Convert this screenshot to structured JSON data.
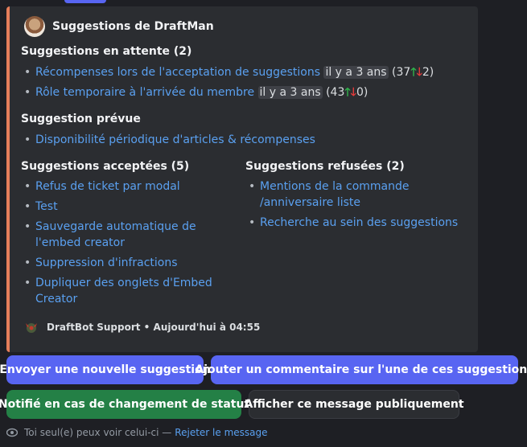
{
  "embed": {
    "accent_color": "#e67e5a",
    "author": {
      "name": "Suggestions de DraftMan"
    },
    "pending": {
      "title": "Suggestions en attente (2)",
      "items": [
        {
          "label": "Récompenses lors de l'acceptation de suggestions",
          "time": "il y a 3 ans",
          "up": "37",
          "down": "2"
        },
        {
          "label": "Rôle temporaire à l'arrivée du membre",
          "time": "il y a 3 ans",
          "up": "43",
          "down": "0"
        }
      ]
    },
    "planned": {
      "title": "Suggestion prévue",
      "items": [
        "Disponibilité périodique d'articles & récompenses"
      ]
    },
    "accepted": {
      "title": "Suggestions acceptées (5)",
      "items": [
        "Refus de ticket par modal",
        "Test",
        "Sauvegarde automatique de l'embed creator",
        "Suppression d'infractions",
        "Dupliquer des onglets d'Embed Creator"
      ]
    },
    "refused": {
      "title": "Suggestions refusées (2)",
      "items": [
        "Mentions de la commande /anniversaire liste",
        "Recherche au sein des suggestions"
      ]
    },
    "footer": {
      "text": "DraftBot Support • Aujourd'hui à 04:55"
    }
  },
  "buttons": {
    "new_suggestion": "Envoyer une nouvelle suggestion",
    "add_comment": "Ajouter un commentaire sur l'une de ces suggestions",
    "notify": "Notifié en cas de changement de statut",
    "public": "Afficher ce message publiquement"
  },
  "ephemeral": {
    "text": "Toi seul(e) peux voir celui-ci — ",
    "dismiss": "Rejeter le message"
  },
  "icons": {
    "up": "green-up-arrow-icon",
    "down": "red-down-arrow-icon",
    "eye": "eye-icon"
  }
}
